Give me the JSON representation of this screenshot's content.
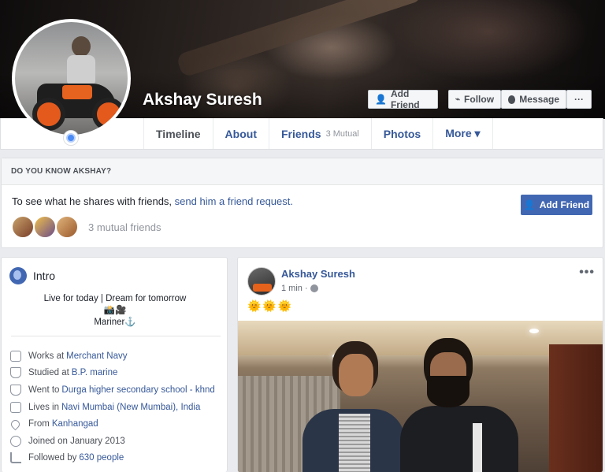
{
  "profile": {
    "name": "Akshay Suresh"
  },
  "cover_actions": {
    "add_friend": "Add Friend",
    "follow": "Follow",
    "message": "Message",
    "more": "···"
  },
  "tabs": [
    {
      "label": "Timeline",
      "extra": ""
    },
    {
      "label": "About",
      "extra": ""
    },
    {
      "label": "Friends",
      "extra": "3 Mutual"
    },
    {
      "label": "Photos",
      "extra": ""
    },
    {
      "label": "More ▾",
      "extra": ""
    }
  ],
  "know_card": {
    "heading": "DO YOU KNOW AKSHAY?",
    "text_prefix": "To see what he shares with friends, ",
    "link_text": "send him a friend request.",
    "mutual_text": "3 mutual friends",
    "button_label": "Add Friend"
  },
  "intro": {
    "title": "Intro",
    "bio_line1": "Live for today | Dream for tomorrow",
    "bio_line2": "📸🎥",
    "bio_line3": "Mariner⚓",
    "items": [
      {
        "prefix": "Works at",
        "link": "Merchant Navy",
        "icon": "briefcase-icon"
      },
      {
        "prefix": "Studied at",
        "link": "B.P. marine",
        "icon": "graduation-cap-icon"
      },
      {
        "prefix": "Went to",
        "link": "Durga higher secondary school - khnd",
        "icon": "graduation-cap-icon"
      },
      {
        "prefix": "Lives in",
        "link": "Navi Mumbai (New Mumbai), India",
        "icon": "home-icon"
      },
      {
        "prefix": "From",
        "link": "Kanhangad",
        "icon": "location-pin-icon"
      },
      {
        "prefix": "Joined on January 2013",
        "link": "",
        "icon": "clock-icon"
      },
      {
        "prefix": "Followed by",
        "link": "630 people",
        "icon": "rss-icon"
      }
    ]
  },
  "post": {
    "author": "Akshay Suresh",
    "time": "1 min ·",
    "more": "•••",
    "text": "🌞🌞🌞"
  }
}
